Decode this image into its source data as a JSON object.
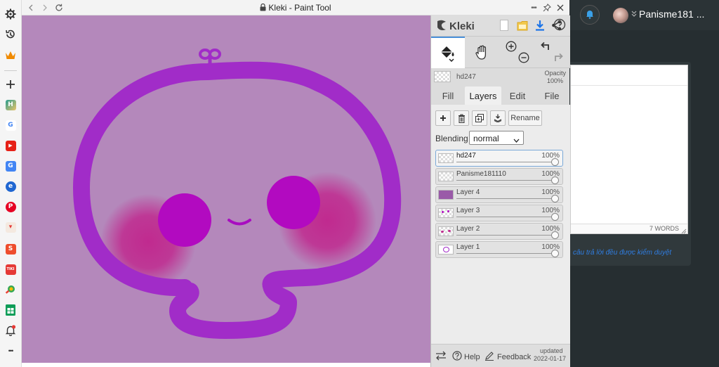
{
  "window": {
    "title": "Kleki - Paint Tool"
  },
  "kleki": {
    "logo": "Kleki",
    "current_layer": "hd247",
    "opacity_label": "Opacity",
    "opacity_value": "100%",
    "tabs": [
      "Fill",
      "Layers",
      "Edit",
      "File"
    ],
    "active_tab": "Layers",
    "rename_label": "Rename",
    "blending_label": "Blending",
    "blending_value": "normal",
    "layers": [
      {
        "name": "hd247",
        "opacity": "100%",
        "active": true
      },
      {
        "name": "Panisme181110",
        "opacity": "100%",
        "active": false
      },
      {
        "name": "Layer 4",
        "opacity": "100%",
        "active": false
      },
      {
        "name": "Layer 3",
        "opacity": "100%",
        "active": false
      },
      {
        "name": "Layer 2",
        "opacity": "100%",
        "active": false
      },
      {
        "name": "Layer 1",
        "opacity": "100%",
        "active": false
      }
    ],
    "help_label": "Help",
    "feedback_label": "Feedback",
    "updated_label": "updated",
    "updated_date": "2022-01-17"
  },
  "background_page": {
    "username": "Panisme181 ...",
    "word_count": "7 WORDS",
    "notice": "câu trả lời đều được kiểm duyệt"
  },
  "sidebar": {
    "items": [
      {
        "icon": "gear-icon",
        "label": ""
      },
      {
        "icon": "history-icon",
        "label": ""
      },
      {
        "icon": "crown-icon",
        "label": ""
      },
      {
        "icon": "plus-icon",
        "label": ""
      },
      {
        "icon": "h-app-icon",
        "label": "H"
      },
      {
        "icon": "google-icon",
        "label": "G"
      },
      {
        "icon": "youtube-icon",
        "label": "▶"
      },
      {
        "icon": "translate-icon",
        "label": "G"
      },
      {
        "icon": "e-app-icon",
        "label": "e"
      },
      {
        "icon": "pinterest-icon",
        "label": "P"
      },
      {
        "icon": "gift-icon",
        "label": "▾"
      },
      {
        "icon": "shopee-icon",
        "label": "S"
      },
      {
        "icon": "tiki-icon",
        "label": "TIKI"
      },
      {
        "icon": "search-app-icon",
        "label": ""
      },
      {
        "icon": "sheets-icon",
        "label": ""
      },
      {
        "icon": "bell-icon",
        "label": ""
      },
      {
        "icon": "more-icon",
        "label": "•••"
      }
    ]
  },
  "colors": {
    "canvas_bg": "#b488bb",
    "outline": "#a12cc8",
    "eyes": "#b20ac0",
    "blush": "#c02a8f",
    "panel": "#dcdcdc",
    "dark_bg": "#262e31",
    "accent_blue": "#1a73e8"
  }
}
